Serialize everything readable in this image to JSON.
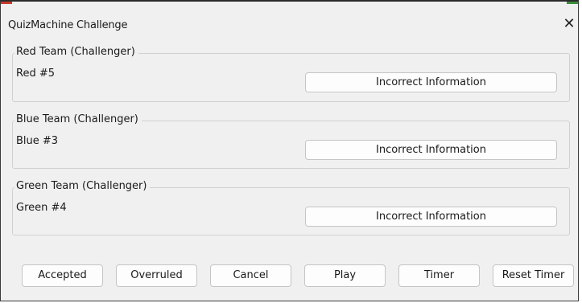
{
  "window": {
    "title": "QuizMachine Challenge",
    "close_icon": "close-icon",
    "close_glyph": "✕"
  },
  "teams": [
    {
      "legend": "Red Team (Challenger)",
      "player": "Red #5",
      "button_label": "Incorrect Information"
    },
    {
      "legend": "Blue Team (Challenger)",
      "player": "Blue #3",
      "button_label": "Incorrect Information"
    },
    {
      "legend": "Green Team (Challenger)",
      "player": "Green #4",
      "button_label": "Incorrect Information"
    }
  ],
  "actions": {
    "accepted": "Accepted",
    "overruled": "Overruled",
    "cancel": "Cancel",
    "play": "Play",
    "timer": "Timer",
    "reset_timer": "Reset Timer"
  },
  "colors": {
    "background": "#f0f0f0",
    "button_face": "#fdfdfd",
    "button_border": "#c5c5c5",
    "group_border": "#d0d0d0"
  }
}
